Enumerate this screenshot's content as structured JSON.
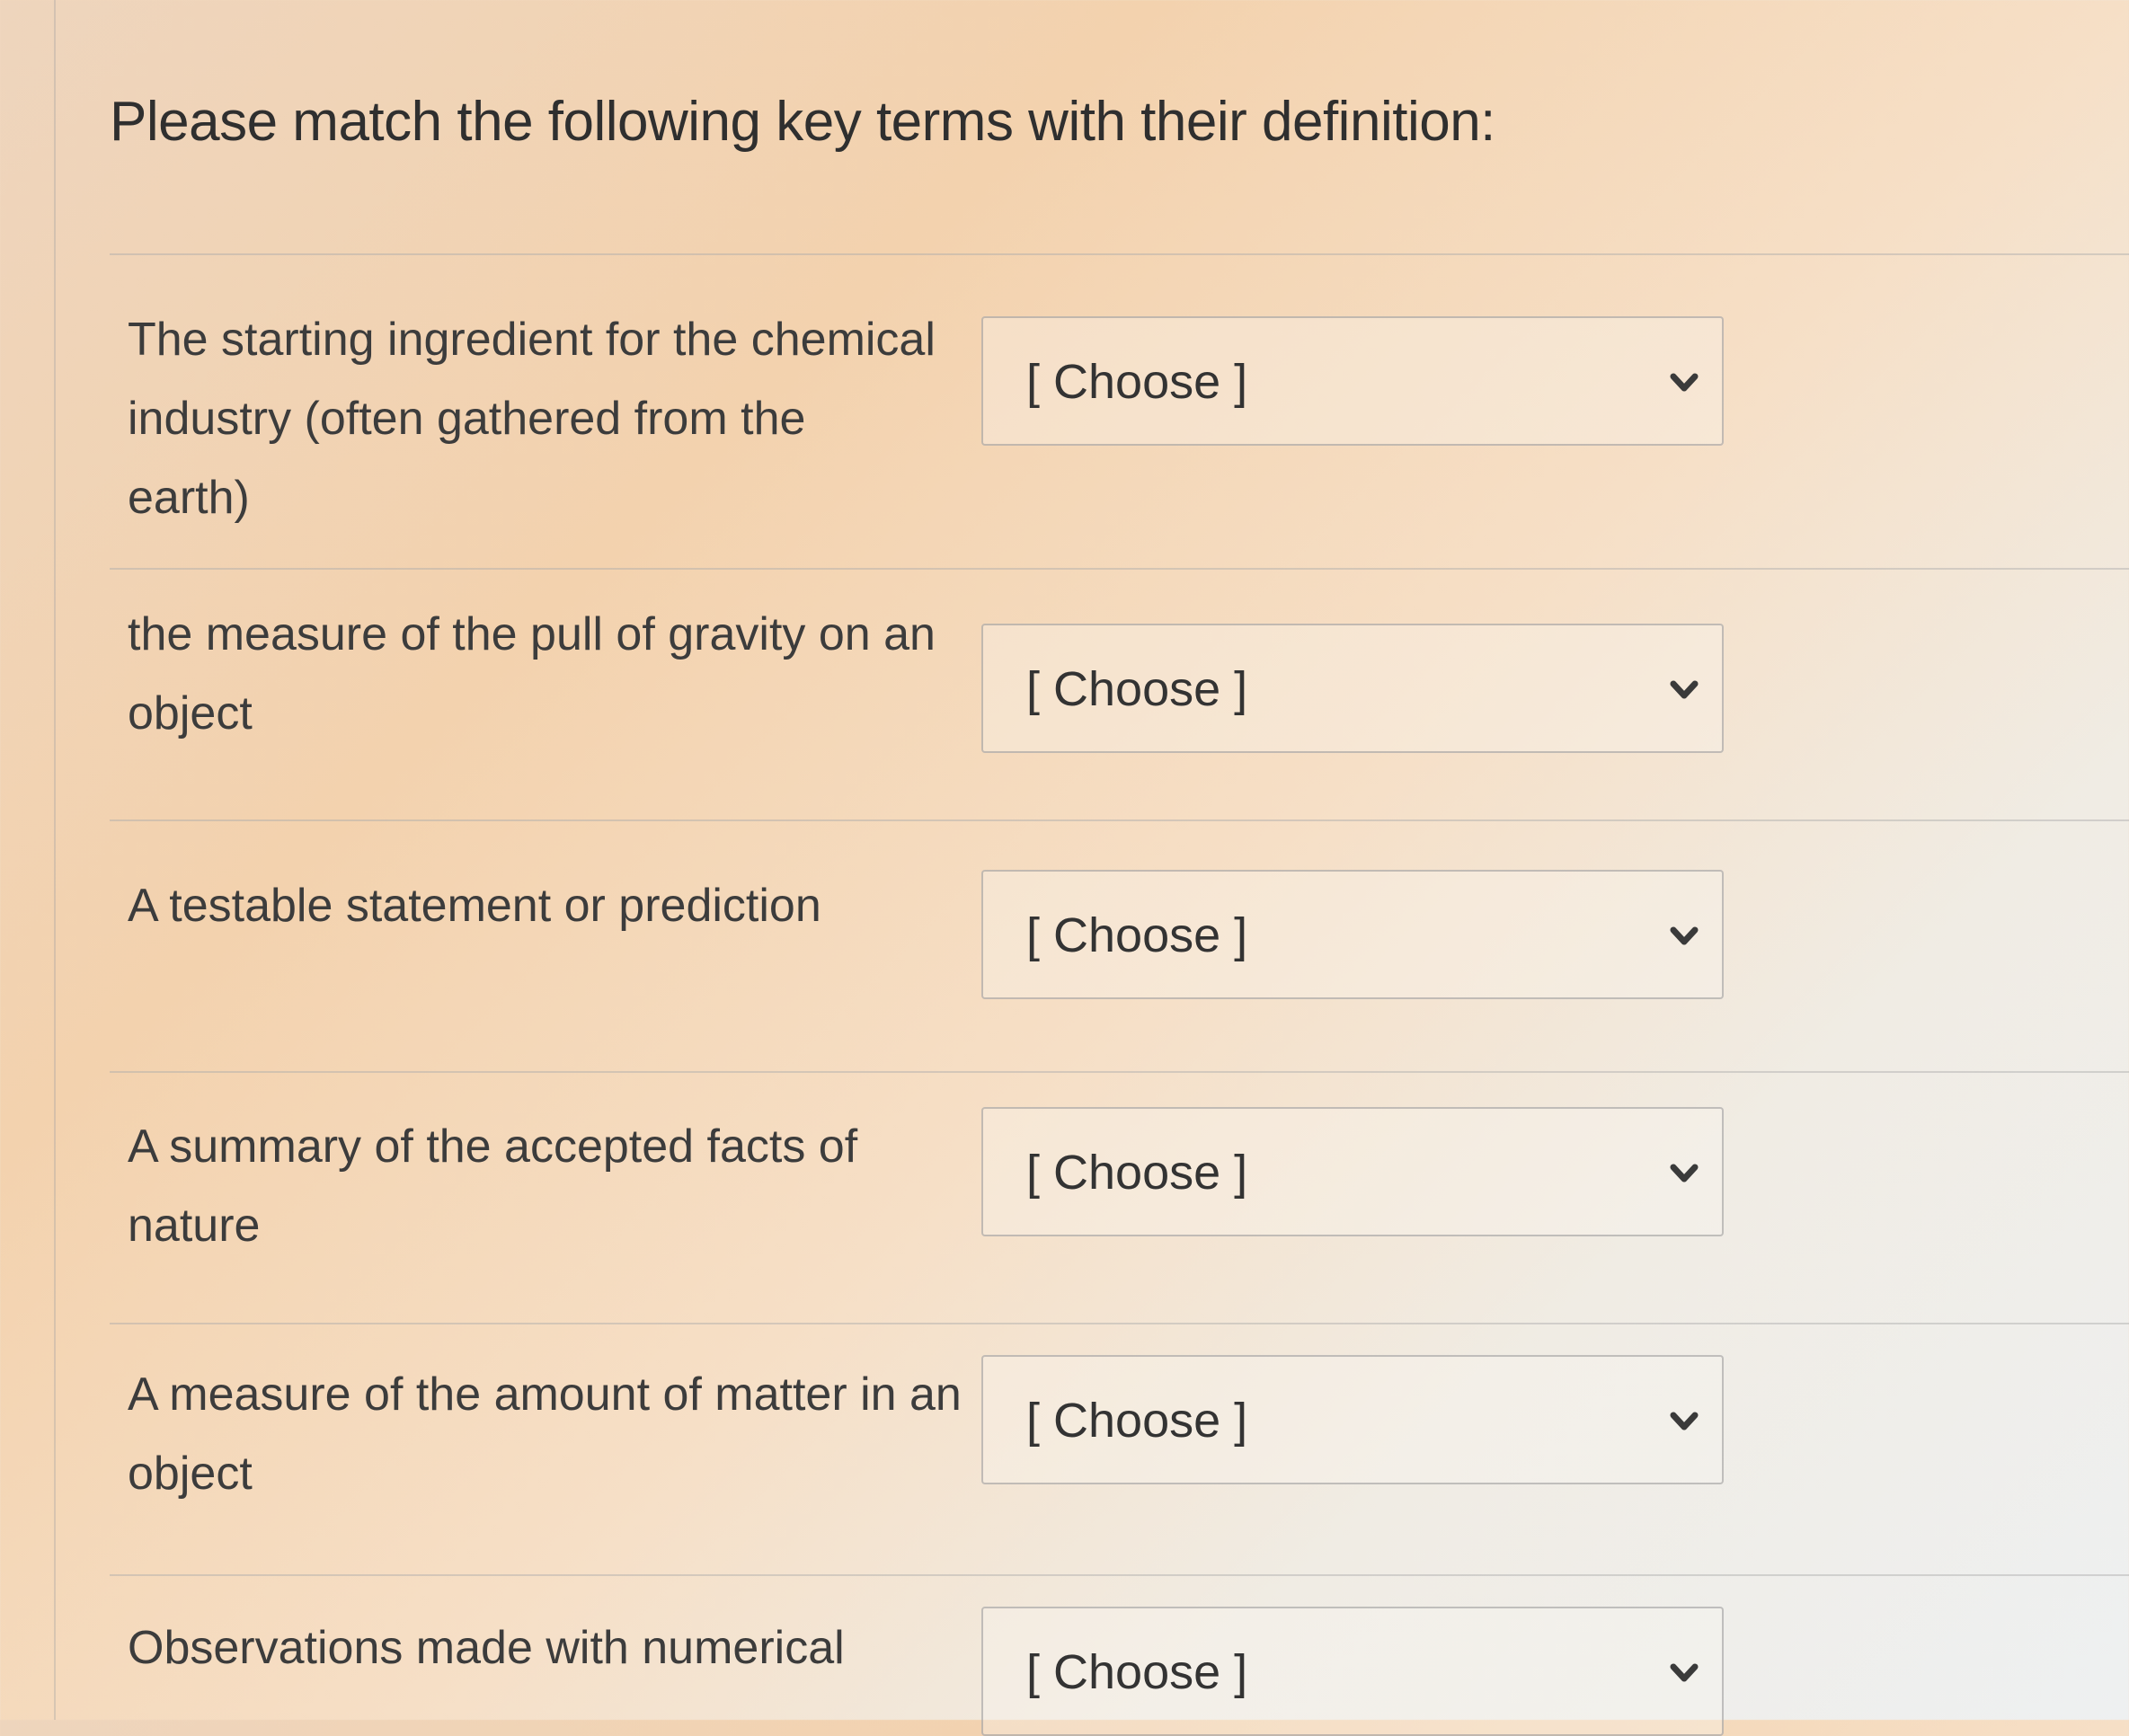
{
  "question": {
    "title": "Please match the following key terms with their definition:"
  },
  "rows": [
    {
      "term": "The starting ingredient for the chemical industry (often gathered from the earth)",
      "selected": "[ Choose ]"
    },
    {
      "term": "the measure of the pull of gravity on an object",
      "selected": "[ Choose ]"
    },
    {
      "term": "A testable statement or prediction",
      "selected": "[ Choose ]"
    },
    {
      "term": "A summary of the accepted facts of nature",
      "selected": "[ Choose ]"
    },
    {
      "term": "A measure of the amount of matter in an object",
      "selected": "[ Choose ]"
    },
    {
      "term": "Observations made with numerical",
      "selected": "[ Choose ]"
    }
  ],
  "icons": {
    "dropdown": "chevron-down-icon"
  }
}
